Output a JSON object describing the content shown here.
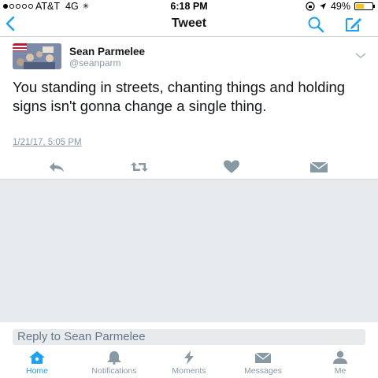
{
  "status_bar": {
    "carrier": "AT&T",
    "network": "4G",
    "time": "6:18 PM",
    "battery": "49%",
    "battery_level": 0.49,
    "signal_dots_filled": 1,
    "signal_dots_total": 5
  },
  "nav": {
    "back_icon": "chevron-left-icon",
    "title": "Tweet",
    "search_icon": "search-icon",
    "compose_icon": "compose-icon"
  },
  "tweet": {
    "author_name": "Sean Parmelee",
    "author_handle": "@seanparm",
    "text": "You standing in streets, chanting things and holding signs isn't gonna change a single thing.",
    "timestamp": "1/21/17, 5:05 PM",
    "actions": [
      "reply-icon",
      "retweet-icon",
      "heart-icon",
      "envelope-icon"
    ]
  },
  "reply": {
    "placeholder": "Reply to Sean Parmelee"
  },
  "tabs": [
    {
      "label": "Home",
      "icon": "home-icon",
      "active": true
    },
    {
      "label": "Notifications",
      "icon": "bell-icon",
      "active": false
    },
    {
      "label": "Moments",
      "icon": "lightning-icon",
      "active": false
    },
    {
      "label": "Messages",
      "icon": "envelope-icon",
      "active": false
    },
    {
      "label": "Me",
      "icon": "person-icon",
      "active": false
    }
  ],
  "colors": {
    "accent": "#1da1f2",
    "muted": "#8899a6",
    "text": "#14171a",
    "empty_background": "#e8ebee"
  }
}
